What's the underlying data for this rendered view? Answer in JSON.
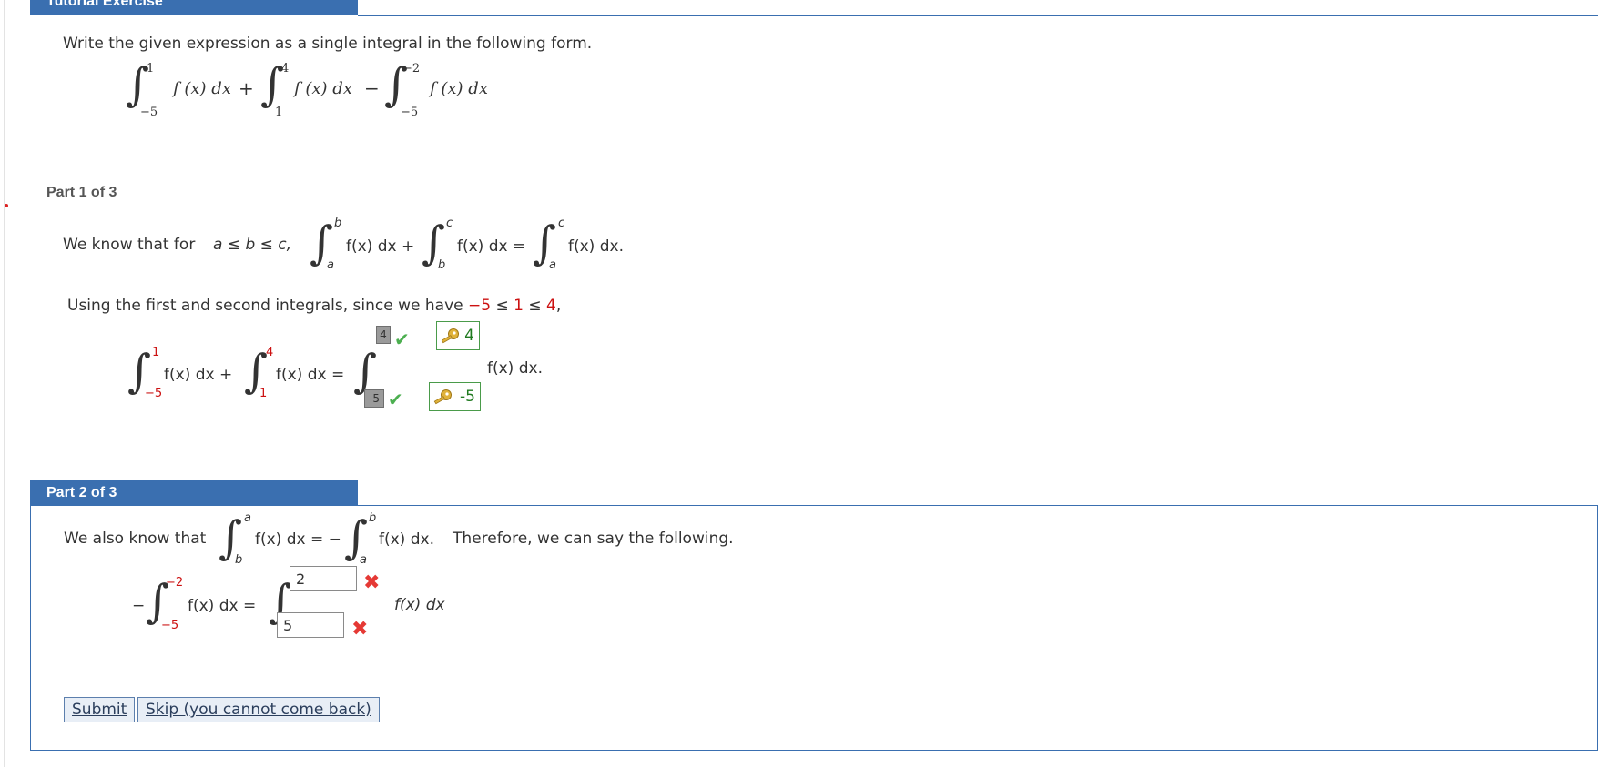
{
  "header": {
    "tab_title": "Tutorial Exercise"
  },
  "intro": {
    "instruction": "Write the given expression as a single integral in the following form.",
    "given": {
      "t1": {
        "lower": "−5",
        "upper": "1",
        "integrand": "f (x) dx"
      },
      "op1": "+",
      "t2": {
        "lower": "1",
        "upper": "4",
        "integrand": "f (x) dx"
      },
      "op2": "−",
      "t3": {
        "lower": "−5",
        "upper": "−2",
        "integrand": "f (x) dx"
      }
    }
  },
  "part1": {
    "label": "Part 1 of 3",
    "we_know": "We know that for",
    "condition": "a ≤ b ≤ c,",
    "rule": {
      "i1": {
        "lower": "a",
        "upper": "b",
        "integrand": "f(x) dx +"
      },
      "i2": {
        "lower": "b",
        "upper": "c",
        "integrand": "f(x) dx ="
      },
      "i3": {
        "lower": "a",
        "upper": "c",
        "integrand": "f(x) dx."
      }
    },
    "using_text": "Using the first and second integrals, since we have",
    "ineq": {
      "a": "−5",
      "le1": " ≤ ",
      "b": "1",
      "le2": " ≤ ",
      "c": "4",
      "end": ","
    },
    "eq": {
      "i1": {
        "lower": "−5",
        "upper": "1",
        "integrand": "f(x) dx +"
      },
      "i2": {
        "lower": "1",
        "upper": "4",
        "integrand": "f(x) dx ="
      },
      "upper_entered": "4",
      "upper_key": "4",
      "lower_entered": "-5",
      "lower_key": "-5",
      "result_integrand": "f(x) dx."
    }
  },
  "part2": {
    "label": "Part 2 of 3",
    "also_text": "We also know that",
    "rule": {
      "i1": {
        "lower": "b",
        "upper": "a",
        "integrand": "f(x) dx = −"
      },
      "i2": {
        "lower": "a",
        "upper": "b",
        "integrand": "f(x) dx."
      }
    },
    "therefore": "Therefore, we can say the following.",
    "eq": {
      "minus": "−",
      "lower": "−5",
      "upper": "−2",
      "integrand": "f(x) dx =",
      "upper_input": "2",
      "lower_input": "5",
      "result_integrand": "f(x) dx"
    },
    "submit_label": "Submit",
    "skip_label": "Skip (you cannot come back)"
  }
}
